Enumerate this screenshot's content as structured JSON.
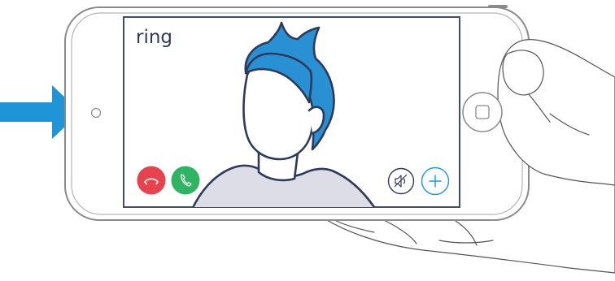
{
  "app": {
    "brand_logo_text": "ring"
  },
  "call_controls": {
    "decline_icon": "phone-hangup-icon",
    "accept_icon": "phone-answer-icon",
    "mute_icon": "speaker-muted-icon",
    "add_icon": "plus-icon"
  },
  "colors": {
    "accent_blue": "#1f95d8",
    "decline_red": "#e8424e",
    "accept_green": "#30b463",
    "outline": "#2e3a57",
    "shirt": "#dcdde6",
    "device_outline": "#8a8a8a"
  }
}
